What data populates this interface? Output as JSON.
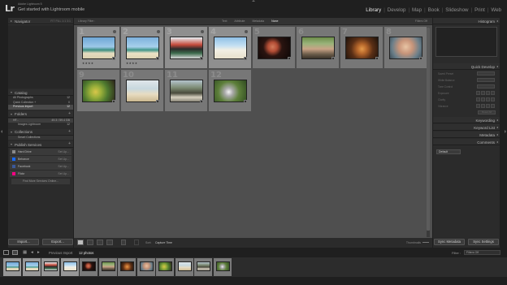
{
  "app": {
    "logo": "Lr",
    "subtitle": "Adobe Lightroom 5",
    "catalog_title": "Get started with Lightroom mobile"
  },
  "modules": [
    {
      "label": "Library",
      "active": true
    },
    {
      "label": "Develop",
      "active": false
    },
    {
      "label": "Map",
      "active": false
    },
    {
      "label": "Book",
      "active": false
    },
    {
      "label": "Slideshow",
      "active": false
    },
    {
      "label": "Print",
      "active": false
    },
    {
      "label": "Web",
      "active": false
    }
  ],
  "left_panel": {
    "navigator": {
      "title": "Navigator",
      "modes": "FIT  FILL  1:1  3:1"
    },
    "catalog": {
      "title": "Catalog",
      "items": [
        {
          "label": "All Photographs",
          "count": "12"
        },
        {
          "label": "Quick Collection +",
          "count": "0"
        },
        {
          "label": "Previous Import",
          "count": "12"
        }
      ]
    },
    "folders": {
      "title": "Folders",
      "volume": {
        "label": "HF...",
        "stats": "49.3 / 59.4 GB"
      },
      "items": [
        {
          "label": "Images Lightroom",
          "count": "12"
        }
      ]
    },
    "collections": {
      "title": "Collections",
      "items": [
        {
          "label": "Smart Collections"
        }
      ]
    },
    "publish_services": {
      "title": "Publish Services",
      "items": [
        {
          "label": "Hard Drive",
          "setup": "Set Up..."
        },
        {
          "label": "Behance",
          "setup": "Set Up..."
        },
        {
          "label": "Facebook",
          "setup": "Set Up..."
        },
        {
          "label": "Flickr",
          "setup": "Set Up..."
        }
      ],
      "find_more": "Find More Services Online..."
    },
    "import_label": "Import...",
    "export_label": "Export..."
  },
  "right_panel": {
    "histogram": {
      "title": "Histogram"
    },
    "quick_develop": {
      "title": "Quick Develop",
      "rows": [
        "Saved Preset",
        "White Balance",
        "Tone Control",
        "Exposure",
        "Clarity",
        "Vibrance"
      ],
      "reset": "Reset All"
    },
    "keywording": {
      "title": "Keywording"
    },
    "keyword_list": {
      "title": "Keyword List"
    },
    "metadata": {
      "title": "Metadata",
      "preset": "Default"
    },
    "comments": {
      "title": "Comments"
    },
    "sync_metadata_label": "Sync Metadata",
    "sync_settings_label": "Sync Settings"
  },
  "filter_bar": {
    "label": "Library Filter :",
    "tabs": [
      {
        "label": "Text",
        "active": false
      },
      {
        "label": "Attribute",
        "active": false
      },
      {
        "label": "Metadata",
        "active": false
      },
      {
        "label": "None",
        "active": true
      }
    ],
    "filters_off": "Filters Off"
  },
  "grid": [
    {
      "index": "1",
      "selected": true,
      "scene": "beach-palms",
      "stars": "★★★★"
    },
    {
      "index": "2",
      "selected": true,
      "scene": "beach-palms-2",
      "stars": "★★★★"
    },
    {
      "index": "3",
      "selected": true,
      "scene": "festival",
      "stars": ""
    },
    {
      "index": "4",
      "selected": true,
      "scene": "beach-flat",
      "stars": ""
    },
    {
      "index": "5",
      "selected": false,
      "scene": "portrait-dark",
      "stars": ""
    },
    {
      "index": "6",
      "selected": false,
      "scene": "man-outdoor",
      "stars": ""
    },
    {
      "index": "7",
      "selected": false,
      "scene": "guitar",
      "stars": ""
    },
    {
      "index": "8",
      "selected": false,
      "scene": "face-closeup",
      "stars": ""
    },
    {
      "index": "9",
      "selected": false,
      "scene": "drink-green",
      "stars": ""
    },
    {
      "index": "10",
      "selected": false,
      "scene": "couple-beach",
      "stars": ""
    },
    {
      "index": "11",
      "selected": false,
      "scene": "street-scene",
      "stars": ""
    },
    {
      "index": "12",
      "selected": false,
      "scene": "bird-green",
      "stars": ""
    }
  ],
  "toolbar": {
    "sort_label": "Sort:",
    "sort_value": "Capture Time",
    "thumbnails_label": "Thumbnails"
  },
  "filmstrip": {
    "source": "Previous Import",
    "count": "12 photos",
    "filter_label": "Filter :",
    "filter_value": "Filters Off"
  }
}
